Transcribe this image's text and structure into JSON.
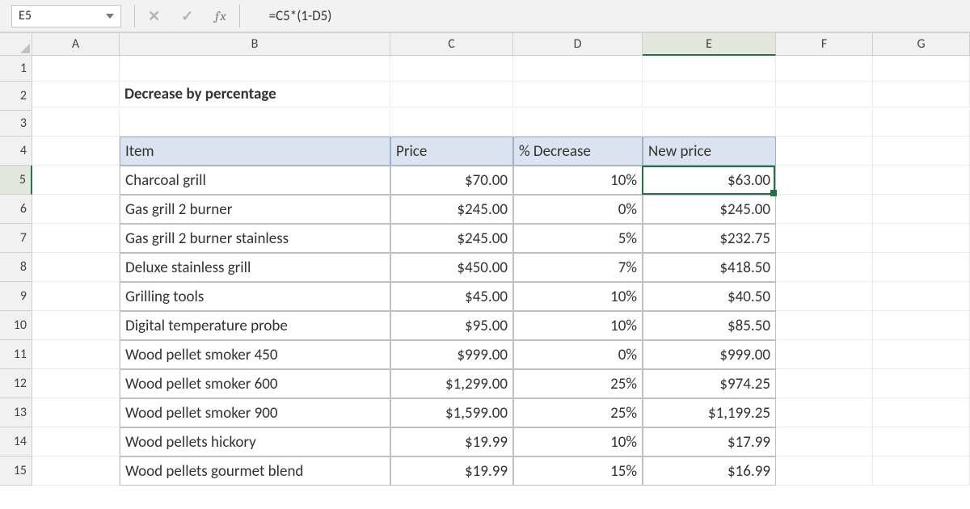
{
  "formula_bar": {
    "name_box": "E5",
    "formula": "=C5*(1-D5)"
  },
  "columns": [
    "A",
    "B",
    "C",
    "D",
    "E",
    "F",
    "G"
  ],
  "rows": [
    "1",
    "2",
    "3",
    "4",
    "5",
    "6",
    "7",
    "8",
    "9",
    "10",
    "11",
    "12",
    "13",
    "14",
    "15"
  ],
  "active_col": "E",
  "active_row": "5",
  "title": "Decrease by percentage",
  "table": {
    "headers": {
      "item": "Item",
      "price": "Price",
      "decrease": "% Decrease",
      "newprice": "New price"
    },
    "rows": [
      {
        "item": "Charcoal grill",
        "price": "$70.00",
        "decrease": "10%",
        "newprice": "$63.00"
      },
      {
        "item": "Gas grill 2 burner",
        "price": "$245.00",
        "decrease": "0%",
        "newprice": "$245.00"
      },
      {
        "item": "Gas grill 2 burner stainless",
        "price": "$245.00",
        "decrease": "5%",
        "newprice": "$232.75"
      },
      {
        "item": "Deluxe stainless grill",
        "price": "$450.00",
        "decrease": "7%",
        "newprice": "$418.50"
      },
      {
        "item": "Grilling tools",
        "price": "$45.00",
        "decrease": "10%",
        "newprice": "$40.50"
      },
      {
        "item": "Digital temperature probe",
        "price": "$95.00",
        "decrease": "10%",
        "newprice": "$85.50"
      },
      {
        "item": "Wood pellet smoker 450",
        "price": "$999.00",
        "decrease": "0%",
        "newprice": "$999.00"
      },
      {
        "item": "Wood pellet smoker 600",
        "price": "$1,299.00",
        "decrease": "25%",
        "newprice": "$974.25"
      },
      {
        "item": "Wood pellet smoker 900",
        "price": "$1,599.00",
        "decrease": "25%",
        "newprice": "$1,199.25"
      },
      {
        "item": "Wood pellets hickory",
        "price": "$19.99",
        "decrease": "10%",
        "newprice": "$17.99"
      },
      {
        "item": "Wood pellets gourmet blend",
        "price": "$19.99",
        "decrease": "15%",
        "newprice": "$16.99"
      }
    ]
  }
}
